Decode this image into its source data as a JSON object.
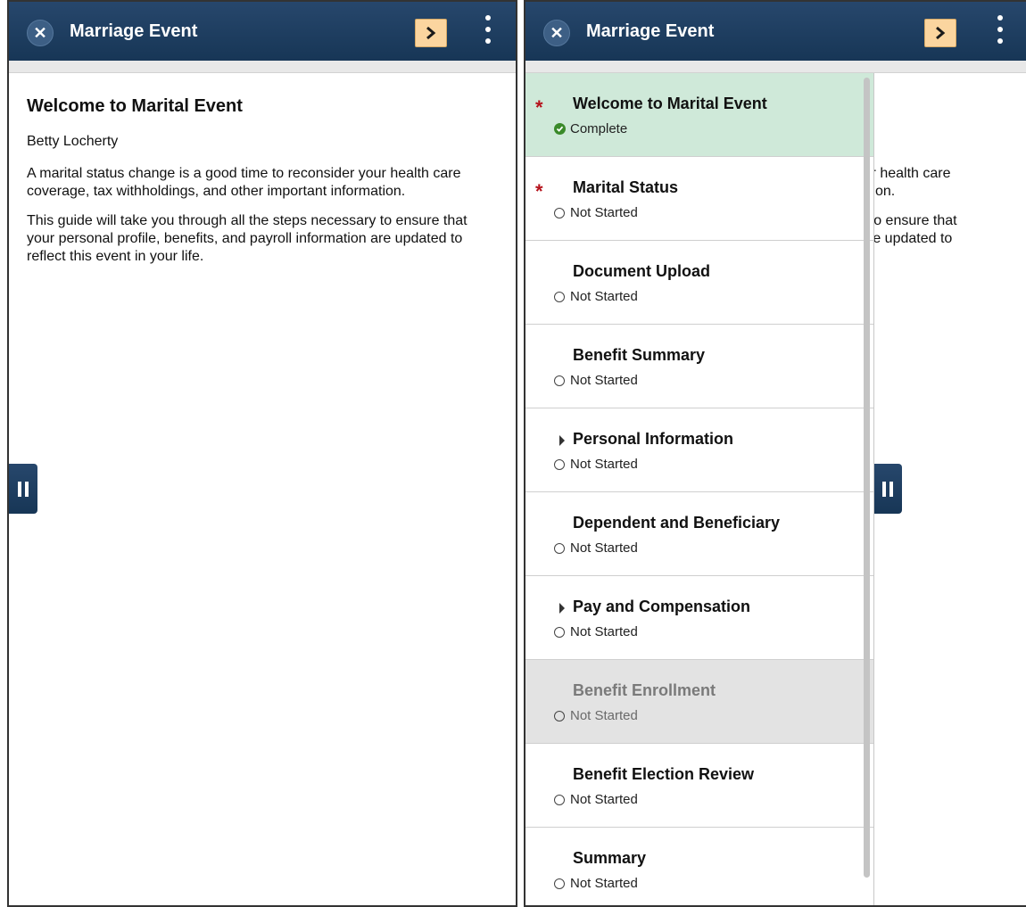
{
  "header": {
    "title": "Marriage Event",
    "close_glyph": "✕",
    "next_icon": "chevron-right-icon",
    "more_icon": "vertical-ellipsis-icon"
  },
  "content": {
    "title": "Welcome to Marital Event",
    "name": "Betty Locherty",
    "paragraph1": "A marital status change is a good time to reconsider your health care coverage, tax withholdings, and other important information.",
    "paragraph2": "This guide will take you through all the steps necessary to ensure that your personal profile, benefits, and payroll information are updated to reflect this event in your life."
  },
  "nav": {
    "items": [
      {
        "label": "Welcome to Marital Event",
        "status": "Complete",
        "required": true,
        "expandable": false,
        "state": "complete"
      },
      {
        "label": "Marital Status",
        "status": "Not Started",
        "required": true,
        "expandable": false,
        "state": "normal"
      },
      {
        "label": "Document Upload",
        "status": "Not Started",
        "required": false,
        "expandable": false,
        "state": "normal"
      },
      {
        "label": "Benefit Summary",
        "status": "Not Started",
        "required": false,
        "expandable": false,
        "state": "normal"
      },
      {
        "label": "Personal Information",
        "status": "Not Started",
        "required": false,
        "expandable": true,
        "state": "normal"
      },
      {
        "label": "Dependent and Beneficiary",
        "status": "Not Started",
        "required": false,
        "expandable": false,
        "state": "normal"
      },
      {
        "label": "Pay and Compensation",
        "status": "Not Started",
        "required": false,
        "expandable": true,
        "state": "normal"
      },
      {
        "label": "Benefit Enrollment",
        "status": "Not Started",
        "required": false,
        "expandable": false,
        "state": "disabled"
      },
      {
        "label": "Benefit Election Review",
        "status": "Not Started",
        "required": false,
        "expandable": false,
        "state": "normal"
      },
      {
        "label": "Summary",
        "status": "Not Started",
        "required": false,
        "expandable": false,
        "state": "normal"
      }
    ]
  },
  "colors": {
    "header": "#1f3e61",
    "next_button": "#fbd59f",
    "complete_bg": "#cfe9d9",
    "disabled_bg": "#e3e3e3",
    "required_star": "#b5121b",
    "complete_check": "#3a8a2a"
  }
}
